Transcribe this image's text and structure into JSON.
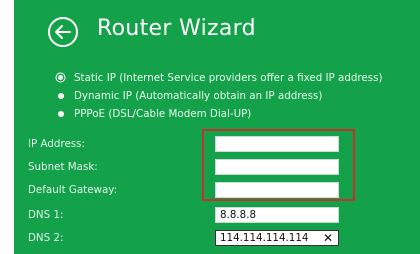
{
  "header": {
    "back_icon": "back-arrow-circle-icon",
    "title": "Router Wizard"
  },
  "connection_types": [
    {
      "label": "Static IP (Internet Service providers offer a fixed IP address)",
      "selected": true
    },
    {
      "label": "Dynamic IP (Automatically obtain an IP address)",
      "selected": false
    },
    {
      "label": "PPPoE (DSL/Cable Modem Dial-UP)",
      "selected": false
    }
  ],
  "fields": {
    "ip_address": {
      "label": "IP Address:",
      "value": ""
    },
    "subnet_mask": {
      "label": "Subnet Mask:",
      "value": ""
    },
    "default_gateway": {
      "label": "Default Gateway:",
      "value": ""
    },
    "dns1": {
      "label": "DNS 1:",
      "value": "8.8.8.8"
    },
    "dns2": {
      "label": "DNS 2:",
      "value": "114.114.114.114",
      "clear_symbol": "✕"
    }
  },
  "colors": {
    "panel_bg": "#13a24a",
    "highlight_border": "#c5322d"
  }
}
